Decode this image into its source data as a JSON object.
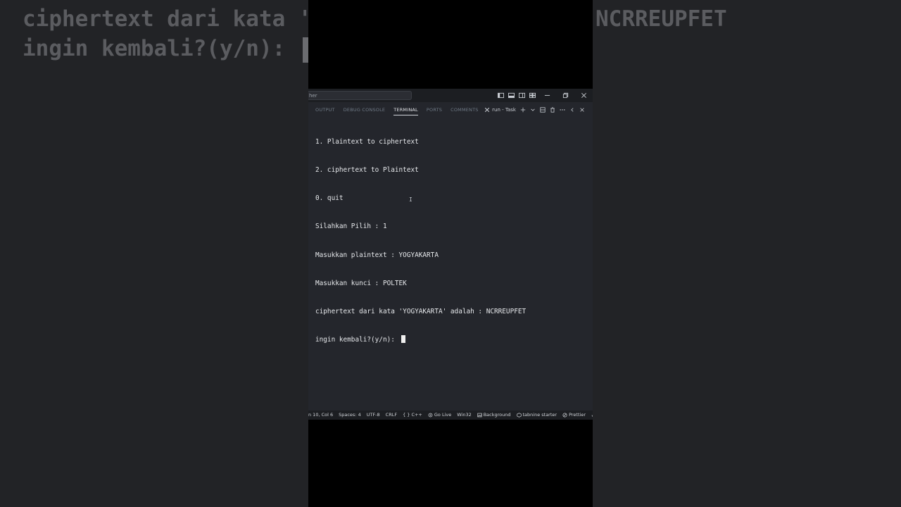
{
  "background": {
    "left_lines": [
      "ciphertext dari kata '",
      "ingin kembali?(y/n): "
    ],
    "right_lines": [
      "NCRREUPFET"
    ]
  },
  "titlebar": {
    "search_text": "her"
  },
  "panel": {
    "tabs": [
      {
        "label": "OUTPUT"
      },
      {
        "label": "DEBUG CONSOLE"
      },
      {
        "label": "TERMINAL"
      },
      {
        "label": "PORTS"
      },
      {
        "label": "COMMENTS"
      }
    ],
    "active_tab": "TERMINAL",
    "task_label": "run - Task"
  },
  "terminal": {
    "lines": [
      "1. Plaintext to ciphertext",
      "2. ciphertext to Plaintext",
      "0. quit",
      "Silahkan Pilih : 1",
      "Masukkan plaintext : YOGYAKARTA",
      "Masukkan kunci : POLTEK",
      "ciphertext dari kata 'YOGYAKARTA' adalah : NCRREUPFET",
      "ingin kembali?(y/n): "
    ]
  },
  "statusbar": {
    "position": "n 10, Col 6",
    "spaces": "Spaces: 4",
    "encoding": "UTF-8",
    "eol": "CRLF",
    "language": "C++",
    "golive": "Go Live",
    "platform": "Win32",
    "background": "Background",
    "tabnine": "tabnine starter",
    "prettier": "Prettier"
  },
  "colors": {
    "editor_bg": "#24262c",
    "titlebar_bg": "#1c1e22",
    "terminal_text": "#e6e8eb",
    "tab_inactive": "#6f7a86"
  }
}
